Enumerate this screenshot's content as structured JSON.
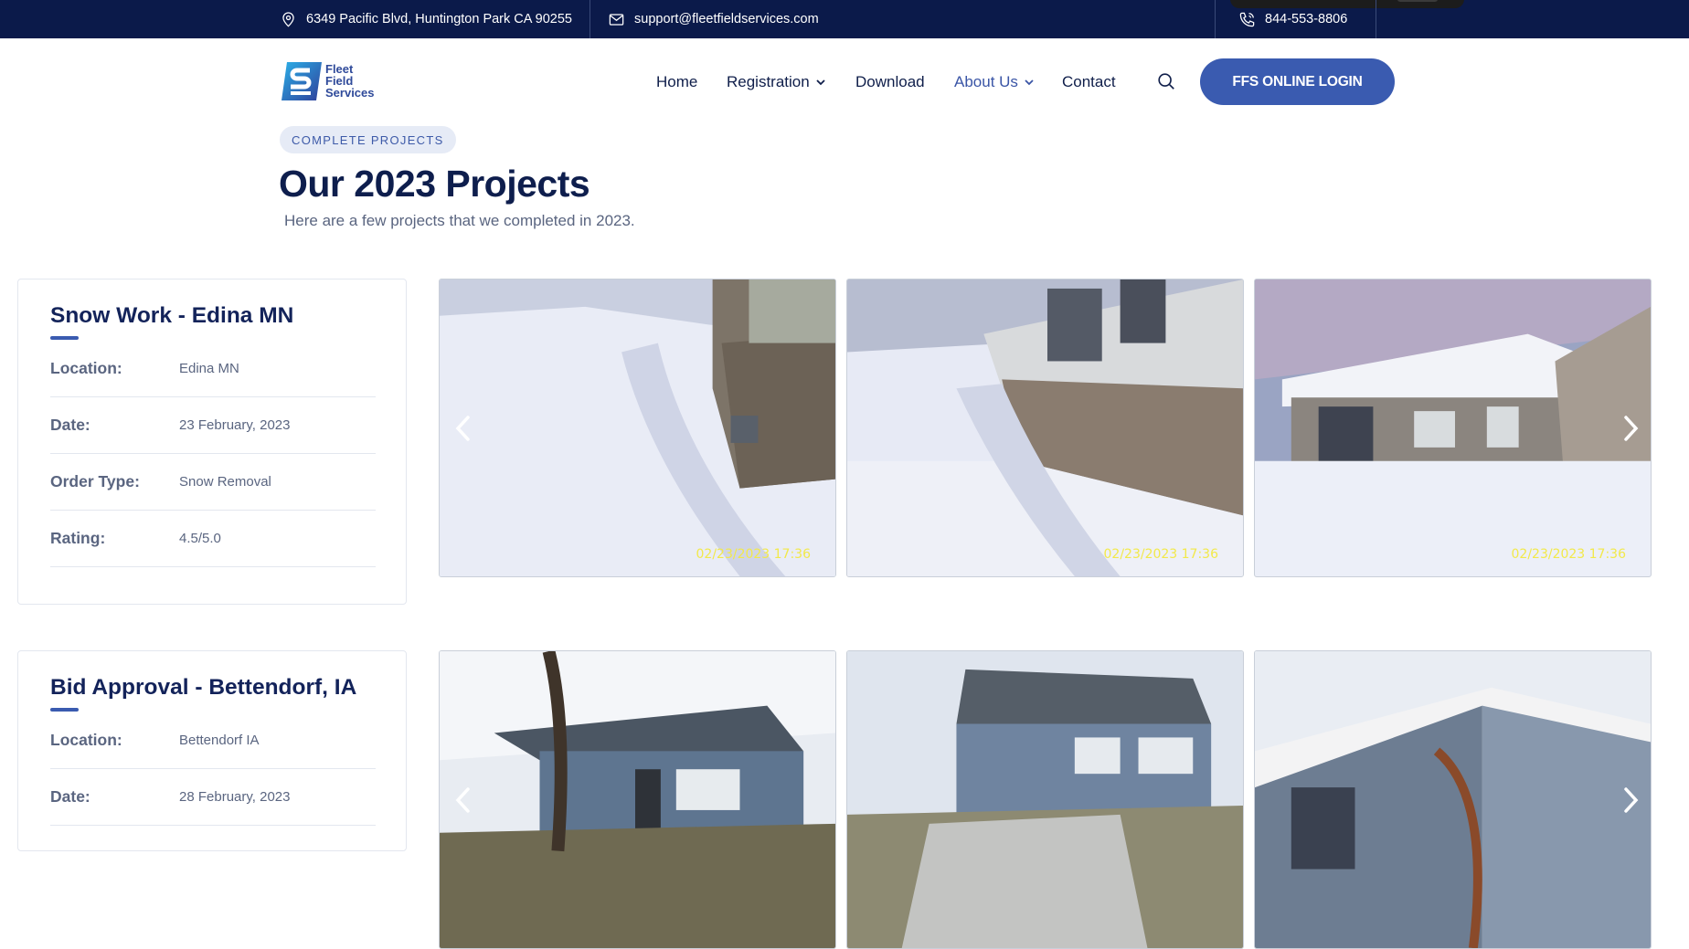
{
  "topbar": {
    "address": "6349 Pacific Blvd, Huntington Park CA 90255",
    "email": "support@fleetfieldservices.com",
    "phone": "844-553-8806"
  },
  "logo": {
    "line1": "Fleet",
    "line2": "Field",
    "line3": "Services"
  },
  "nav": {
    "home": "Home",
    "registration": "Registration",
    "download": "Download",
    "about": "About Us",
    "contact": "Contact",
    "login": "FFS ONLINE LOGIN"
  },
  "heading": {
    "badge": "COMPLETE PROJECTS",
    "title": "Our 2023 Projects",
    "subtitle": "Here are a few projects that we completed in 2023."
  },
  "projects": [
    {
      "title": "Snow Work - Edina MN",
      "fields": [
        {
          "label": "Location:",
          "value": "Edina MN"
        },
        {
          "label": "Date:",
          "value": "23 February, 2023"
        },
        {
          "label": "Order Type:",
          "value": "Snow Removal"
        },
        {
          "label": "Rating:",
          "value": "4.5/5.0"
        }
      ],
      "photos": [
        {
          "stamp": "02/23/2023 17:36"
        },
        {
          "stamp": "02/23/2023 17:36"
        },
        {
          "stamp": "02/23/2023 17:36"
        }
      ]
    },
    {
      "title": "Bid Approval - Bettendorf, IA",
      "fields": [
        {
          "label": "Location:",
          "value": "Bettendorf IA"
        },
        {
          "label": "Date:",
          "value": "28 February, 2023"
        }
      ],
      "photos": [
        {},
        {},
        {}
      ]
    }
  ],
  "colors": {
    "navy": "#0b1a4a",
    "accent": "#3a5bb0",
    "timestamp": "#f2e94a"
  },
  "icons": [
    "location-pin-icon",
    "mail-icon",
    "phone-icon",
    "chevron-down-icon",
    "search-icon",
    "chevron-left-icon",
    "chevron-right-icon"
  ]
}
